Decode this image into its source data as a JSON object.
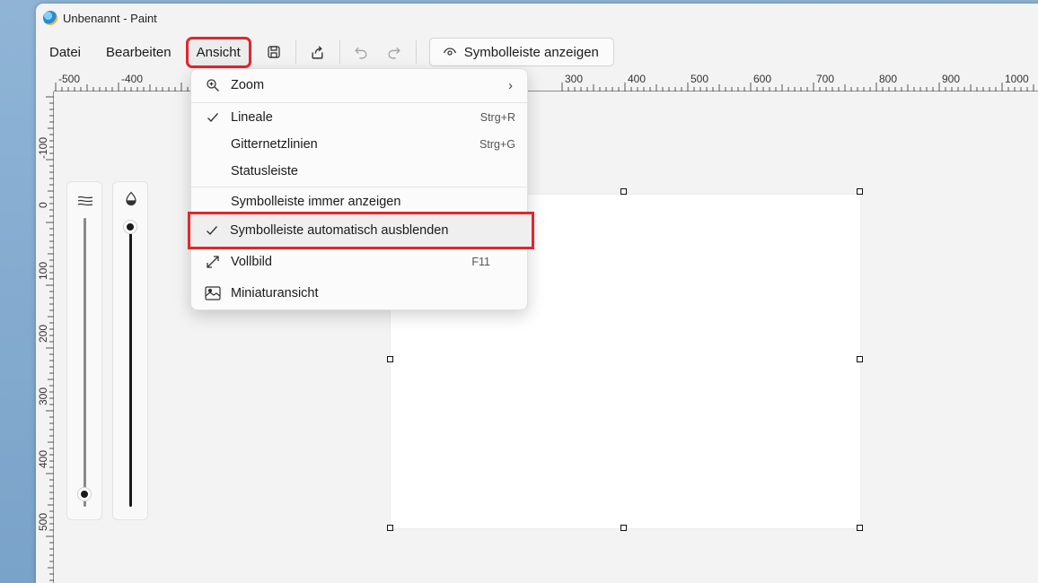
{
  "window": {
    "title": "Unbenannt - Paint"
  },
  "menubar": {
    "items": [
      "Datei",
      "Bearbeiten",
      "Ansicht"
    ],
    "show_toolbar_label": "Symbolleiste anzeigen",
    "toolbar_icons": [
      "save-icon",
      "share-icon",
      "undo-icon",
      "redo-icon"
    ]
  },
  "ruler_top": [
    "-500",
    "-400",
    "300",
    "400",
    "500",
    "600",
    "700",
    "800",
    "900",
    "1000"
  ],
  "ruler_left": [
    "-100",
    "0",
    "100",
    "200",
    "300",
    "400",
    "500"
  ],
  "view_menu": {
    "zoom": "Zoom",
    "rulers": "Lineale",
    "rulers_shortcut": "Strg+R",
    "gridlines": "Gitternetzlinien",
    "gridlines_shortcut": "Strg+G",
    "statusbar": "Statusleiste",
    "toolbar_always": "Symbolleiste immer anzeigen",
    "toolbar_autohide": "Symbolleiste automatisch ausblenden",
    "fullscreen": "Vollbild",
    "fullscreen_shortcut": "F11",
    "thumbnail": "Miniaturansicht",
    "checked": [
      "Lineale",
      "Symbolleiste automatisch ausblenden"
    ]
  },
  "colors": {
    "highlight": "#e3262b"
  }
}
